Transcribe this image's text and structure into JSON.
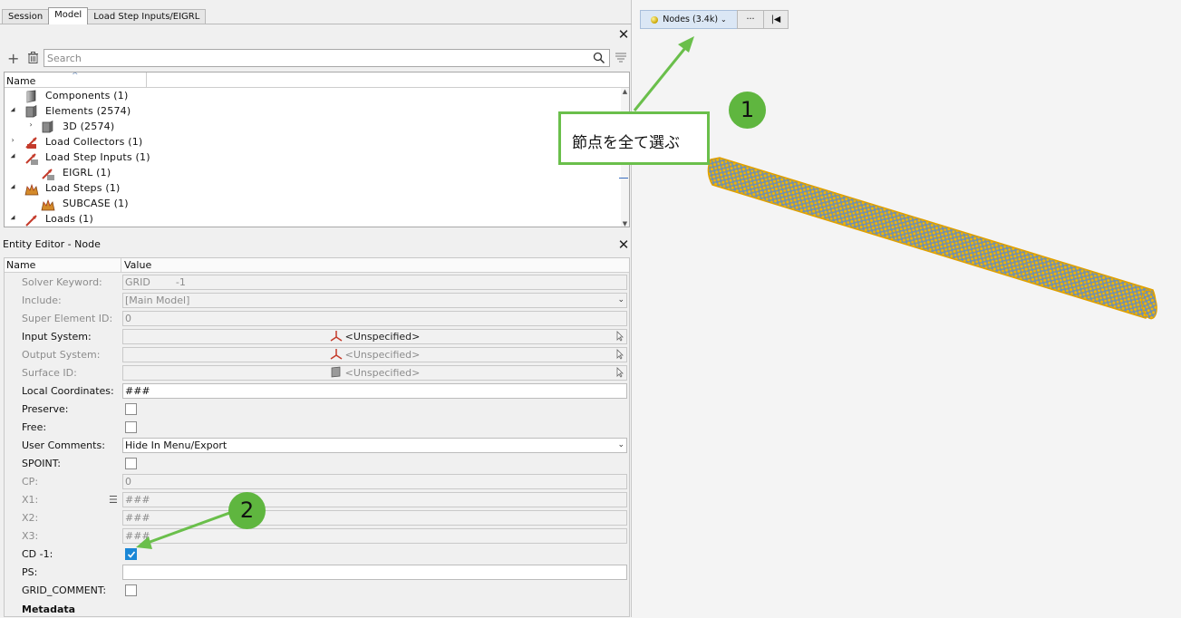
{
  "tabs": [
    {
      "label": "Session"
    },
    {
      "label": "Model"
    },
    {
      "label": "Load Step Inputs/EIGRL"
    }
  ],
  "search": {
    "placeholder": "Search"
  },
  "tree": {
    "column_name": "Name",
    "rows": [
      {
        "label": "Components  (1)"
      },
      {
        "label": "Elements  (2574)"
      },
      {
        "label": "3D  (2574)"
      },
      {
        "label": "Load Collectors  (1)"
      },
      {
        "label": "Load Step Inputs  (1)"
      },
      {
        "label": "EIGRL  (1)"
      },
      {
        "label": "Load Steps  (1)"
      },
      {
        "label": "SUBCASE  (1)"
      },
      {
        "label": "Loads  (1)"
      }
    ]
  },
  "entity_editor": {
    "title": "Entity Editor - Node",
    "col_name": "Name",
    "col_value": "Value",
    "rows": [
      {
        "label": "Solver Keyword:",
        "value": "GRID        -1"
      },
      {
        "label": "Include:",
        "value": "[Main Model]"
      },
      {
        "label": "Super Element ID:",
        "value": "0"
      },
      {
        "label": "Input System:",
        "value": "<Unspecified>"
      },
      {
        "label": "Output System:",
        "value": "<Unspecified>"
      },
      {
        "label": "Surface ID:",
        "value": "<Unspecified>"
      },
      {
        "label": "Local Coordinates:",
        "value": "###"
      },
      {
        "label": "Preserve:"
      },
      {
        "label": "Free:"
      },
      {
        "label": "User Comments:",
        "value": "Hide In Menu/Export"
      },
      {
        "label": "SPOINT:"
      },
      {
        "label": "CP:",
        "value": "0"
      },
      {
        "label": "X1:",
        "value": "###"
      },
      {
        "label": "X2:",
        "value": "###"
      },
      {
        "label": "X3:",
        "value": "###"
      },
      {
        "label": "CD -1:",
        "checked": true
      },
      {
        "label": "PS:",
        "value": ""
      },
      {
        "label": "GRID_COMMENT:"
      }
    ],
    "metadata_label": "Metadata"
  },
  "toolbar": {
    "nodes_label": "Nodes (3.4k)",
    "more_label": "···",
    "first_label": "|◀"
  },
  "annotations": {
    "callout_text": "節点を全て選ぶ",
    "badge1": "1",
    "badge2": "2",
    "color": "#6abf4b"
  },
  "colors": {
    "mesh_node": "#f2b400",
    "mesh_element": "#6f8fb0",
    "checkbox_checked": "#1a87d6"
  }
}
